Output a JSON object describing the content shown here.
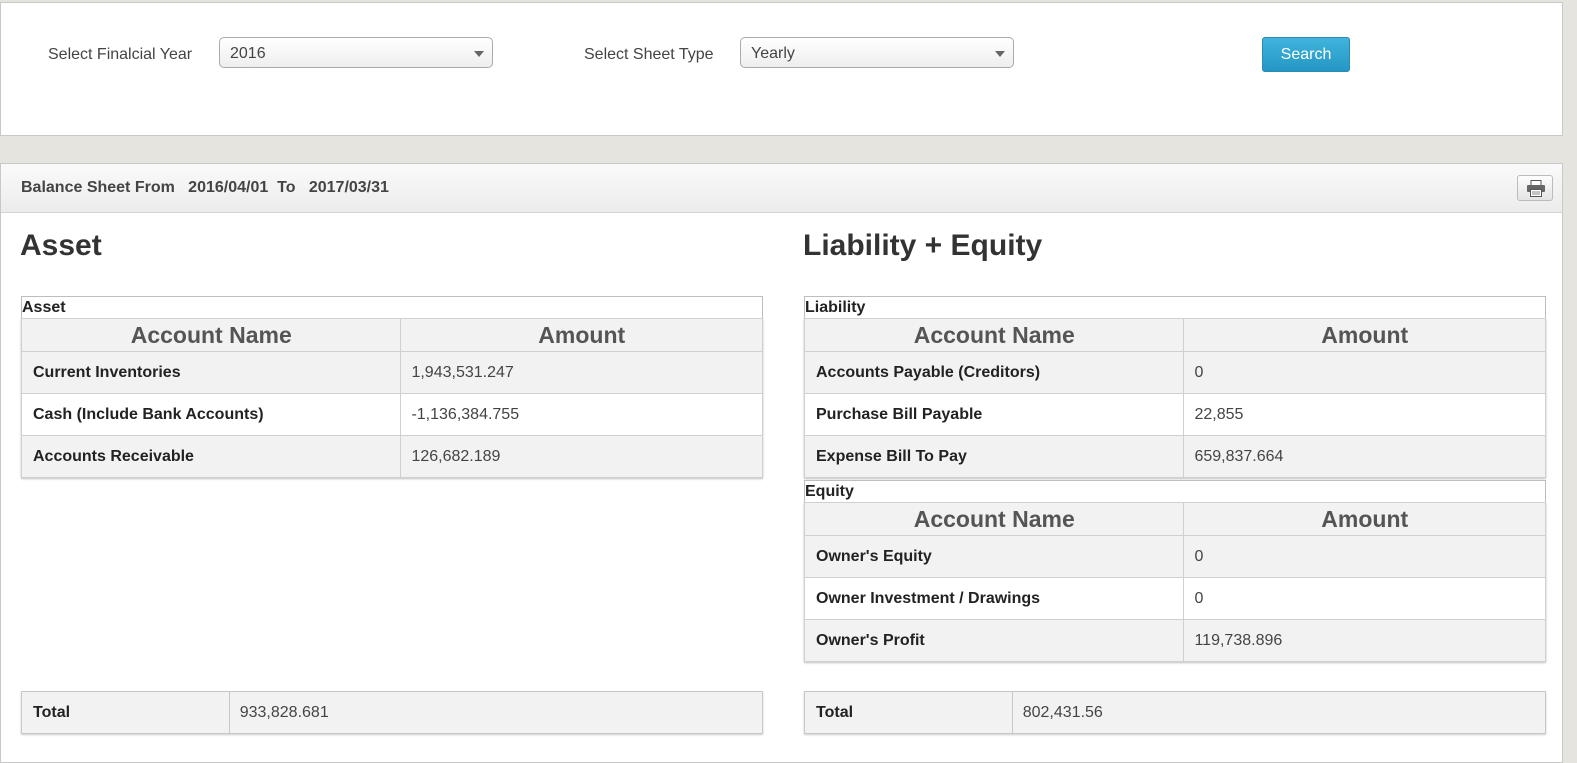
{
  "filters": {
    "year_label": "Select Finalcial Year",
    "year_value": "2016",
    "sheet_type_label": "Select Sheet Type",
    "sheet_type_value": "Yearly",
    "search_label": "Search"
  },
  "sheet": {
    "title_prefix": "Balance Sheet From",
    "from_date": "2016/04/01",
    "to_label": "To",
    "to_date": "2017/03/31"
  },
  "asset": {
    "heading": "Asset",
    "caption": "Asset",
    "col_name": "Account Name",
    "col_amount": "Amount",
    "rows": [
      {
        "name": "Current Inventories",
        "amount": "1,943,531.247"
      },
      {
        "name": "Cash (Include Bank Accounts)",
        "amount": "-1,136,384.755"
      },
      {
        "name": "Accounts Receivable",
        "amount": "126,682.189"
      }
    ],
    "total_label": "Total",
    "total_value": "933,828.681"
  },
  "liability_equity": {
    "heading": "Liability + Equity",
    "liability": {
      "caption": "Liability",
      "col_name": "Account Name",
      "col_amount": "Amount",
      "rows": [
        {
          "name": "Accounts Payable (Creditors)",
          "amount": "0"
        },
        {
          "name": "Purchase Bill Payable",
          "amount": "22,855"
        },
        {
          "name": "Expense Bill To Pay",
          "amount": "659,837.664"
        }
      ]
    },
    "equity": {
      "caption": "Equity",
      "col_name": "Account Name",
      "col_amount": "Amount",
      "rows": [
        {
          "name": "Owner's Equity",
          "amount": "0"
        },
        {
          "name": "Owner Investment / Drawings",
          "amount": "0"
        },
        {
          "name": "Owner's Profit",
          "amount": "119,738.896"
        }
      ]
    },
    "total_label": "Total",
    "total_value": "802,431.56"
  }
}
